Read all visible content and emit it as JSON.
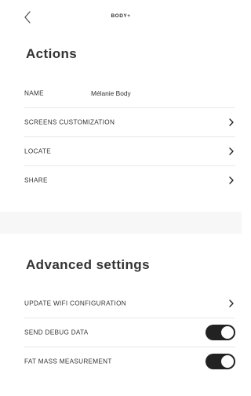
{
  "header": {
    "title": "BODY+",
    "back_icon": "chevron-left-icon"
  },
  "actions": {
    "title": "Actions",
    "name_label": "NAME",
    "name_value": "Mélanie Body",
    "items": [
      {
        "label": "SCREENS CUSTOMIZATION",
        "icon": "chevron-right-icon"
      },
      {
        "label": "LOCATE",
        "icon": "chevron-right-icon"
      },
      {
        "label": "SHARE",
        "icon": "chevron-right-icon"
      }
    ]
  },
  "advanced": {
    "title": "Advanced settings",
    "wifi_label": "UPDATE WIFI CONFIGURATION",
    "debug_label": "SEND DEBUG DATA",
    "debug_enabled": true,
    "fatmass_label": "FAT MASS MEASUREMENT",
    "fatmass_enabled": true
  },
  "colors": {
    "toggle_on": "#222222",
    "separator_band": "#f7f7f7",
    "divider": "#e7e7e7"
  }
}
